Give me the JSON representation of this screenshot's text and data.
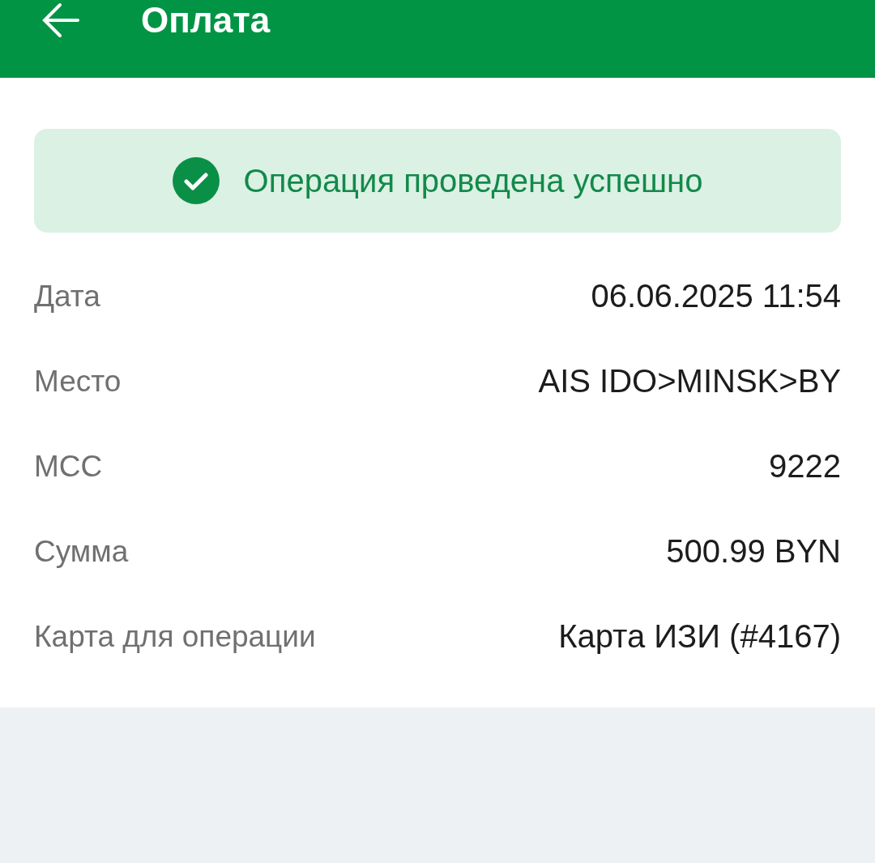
{
  "header": {
    "title": "Оплата"
  },
  "status": {
    "text": "Операция проведена успешно"
  },
  "details": [
    {
      "label": "Дата",
      "value": "06.06.2025 11:54"
    },
    {
      "label": "Место",
      "value": "AIS IDO>MINSK>BY"
    },
    {
      "label": "MCC",
      "value": "9222"
    },
    {
      "label": "Сумма",
      "value": "500.99 BYN"
    },
    {
      "label": "Карта для операции",
      "value": "Карта ИЗИ (#4167)"
    }
  ]
}
